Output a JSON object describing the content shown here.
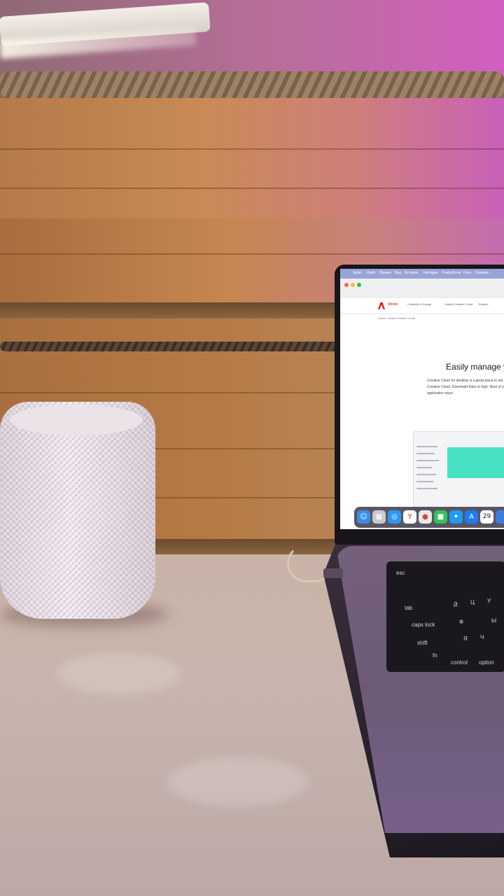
{
  "colors": {
    "screen_menubar": "#9aa3d6",
    "adobe_red": "#eb1000",
    "preview_banner": "#47e1c3"
  },
  "menubar": {
    "items": [
      "Safari",
      "Файл",
      "Правка",
      "Вид",
      "История",
      "Закладки",
      "Разработка",
      "Окно",
      "Справка"
    ]
  },
  "site": {
    "brand": "Adobe",
    "nav": [
      "Creativity & Design",
      "Adobe Creative Cloud",
      "Explore"
    ],
    "breadcrumb": "Home  ›  Adobe Creative Cloud"
  },
  "hero": {
    "title": "Easily manage yo",
    "body": "Creative Cloud for desktop is a great place to sta stored in Creative Cloud. Download fonts or high- Best of all, the application stays"
  },
  "dock": {
    "calendar_day": "29",
    "icons": [
      "finder-icon",
      "launchpad-icon",
      "safari-icon",
      "yandex-browser-icon",
      "chrome-icon",
      "facetime-icon",
      "twitter-icon",
      "app-store-icon",
      "calendar-icon"
    ]
  },
  "keyboard": {
    "labels": [
      "esc",
      "tab",
      "caps lock",
      "shift",
      "fn",
      "control",
      "option",
      "Й",
      "Ц",
      "У",
      "Ф",
      "Ы",
      "Я",
      "Ч"
    ]
  }
}
